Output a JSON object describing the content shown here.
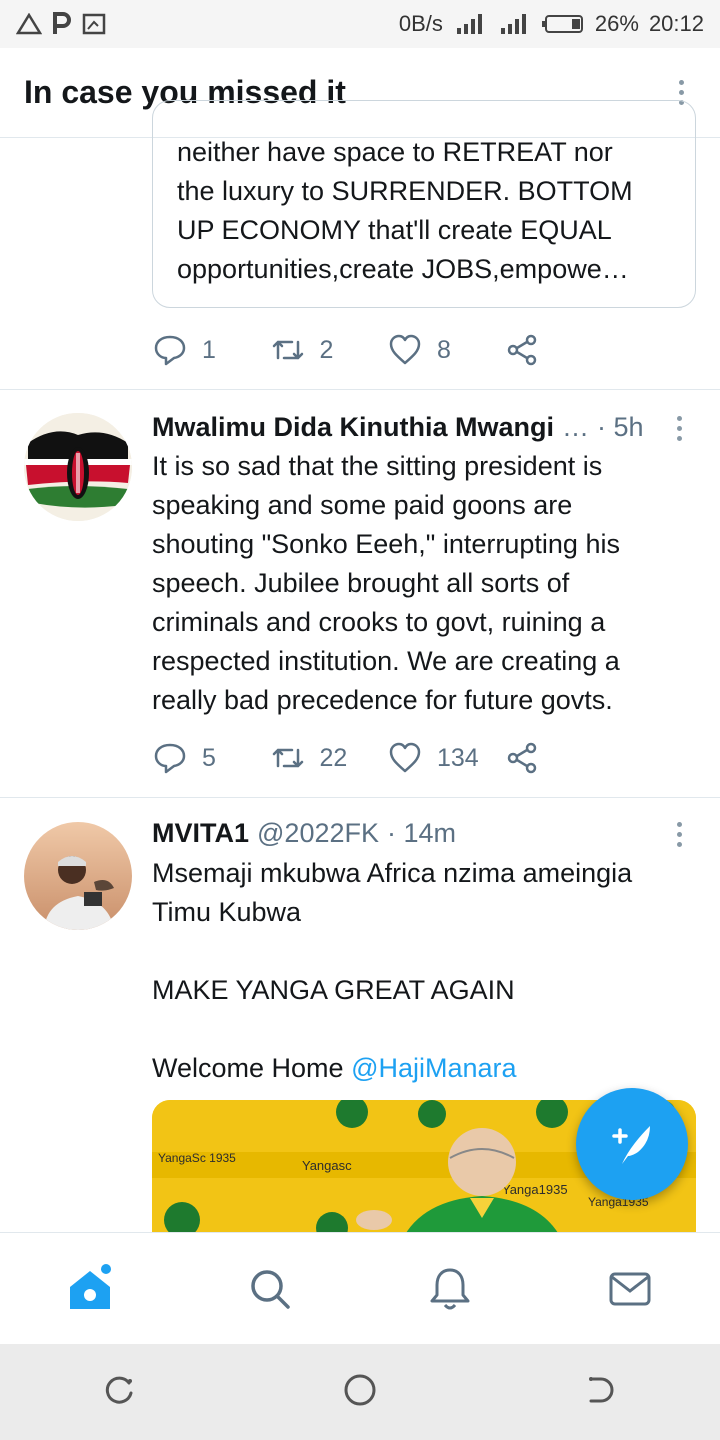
{
  "status_bar": {
    "network_speed": "0B/s",
    "battery": "26%",
    "time": "20:12"
  },
  "header": {
    "title": "In case you missed it"
  },
  "quoted_tweet": {
    "lines": [
      "neither have space to RETREAT nor",
      "the luxury to SURRENDER. BOTTOM",
      "UP ECONOMY that'll create EQUAL",
      "opportunities,create JOBS,empowe…"
    ],
    "replies": "1",
    "retweets": "2",
    "likes": "8"
  },
  "tweet1": {
    "name": "Mwalimu Dida Kinuthia Mwangi",
    "ellipsis": "…",
    "meta": "· 5h",
    "lines": [
      "It is so sad that the sitting president is",
      "speaking and some paid goons are",
      "shouting \"Sonko Eeeh,\" interrupting his",
      "speech. Jubilee brought all sorts of",
      "criminals and crooks to govt, ruining a",
      "respected institution. We are creating a",
      "really bad precedence for future govts."
    ],
    "replies": "5",
    "retweets": "22",
    "likes": "134"
  },
  "tweet2": {
    "name": "MVITA1",
    "handle": "@2022FK",
    "meta": "· 14m",
    "line1": "Msemaji mkubwa Africa nzima ameingia",
    "line2": "Timu Kubwa",
    "line3": "MAKE YANGA GREAT AGAIN",
    "line4_prefix": "Welcome Home ",
    "mention": "@HajiManara",
    "media_texts": [
      "YangaSc 1935",
      "Yangasc",
      "Yanga1935",
      "Yanga1935"
    ]
  },
  "colors": {
    "accent": "#1da1f2",
    "text": "#14171a",
    "muted": "#5b7083",
    "border": "#e1e8ed"
  },
  "icons": [
    "reply-icon",
    "retweet-icon",
    "like-icon",
    "share-icon",
    "home-icon",
    "search-icon",
    "bell-icon",
    "mail-icon",
    "compose-icon"
  ]
}
